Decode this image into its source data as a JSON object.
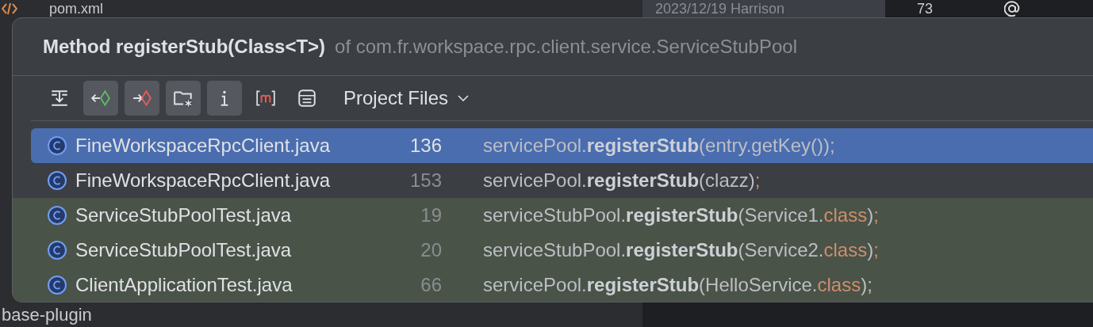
{
  "background": {
    "file_tab": "pom.xml",
    "blame": "2023/12/19 Harrison",
    "count": "73",
    "module": "base-plugin"
  },
  "popup": {
    "title": {
      "method": "Method registerStub(Class<T>)",
      "owner": "of com.fr.workspace.rpc.client.service.ServiceStubPool"
    },
    "toolbar": [
      {
        "on": false
      },
      {
        "on": true
      },
      {
        "on": true
      },
      {
        "on": true
      },
      {
        "on": true
      },
      {
        "on": false
      },
      {
        "on": false
      }
    ],
    "scope": {
      "label": "Project Files"
    },
    "results": [
      {
        "file": "FineWorkspaceRpcClient.java",
        "line": "136",
        "selected": true,
        "test_scope": false,
        "code": [
          {
            "kind": "plain",
            "text": "servicePool."
          },
          {
            "kind": "method",
            "text": "registerStub"
          },
          {
            "kind": "plain",
            "text": "(entry.getKey());"
          }
        ]
      },
      {
        "file": "FineWorkspaceRpcClient.java",
        "line": "153",
        "selected": false,
        "test_scope": false,
        "code": [
          {
            "kind": "plain",
            "text": "servicePool."
          },
          {
            "kind": "method",
            "text": "registerStub"
          },
          {
            "kind": "plain",
            "text": "(clazz)"
          },
          {
            "kind": "keyword",
            "text": ";"
          }
        ]
      },
      {
        "file": "ServiceStubPoolTest.java",
        "line": "19",
        "selected": false,
        "test_scope": true,
        "code": [
          {
            "kind": "plain",
            "text": "serviceStubPool."
          },
          {
            "kind": "method",
            "text": "registerStub"
          },
          {
            "kind": "plain",
            "text": "(Service1."
          },
          {
            "kind": "keyword",
            "text": "class"
          },
          {
            "kind": "plain",
            "text": ")"
          },
          {
            "kind": "keyword",
            "text": ";"
          }
        ]
      },
      {
        "file": "ServiceStubPoolTest.java",
        "line": "20",
        "selected": false,
        "test_scope": true,
        "code": [
          {
            "kind": "plain",
            "text": "serviceStubPool."
          },
          {
            "kind": "method",
            "text": "registerStub"
          },
          {
            "kind": "plain",
            "text": "(Service2."
          },
          {
            "kind": "keyword",
            "text": "class"
          },
          {
            "kind": "plain",
            "text": ")"
          },
          {
            "kind": "keyword",
            "text": ";"
          }
        ]
      },
      {
        "file": "ClientApplicationTest.java",
        "line": "66",
        "selected": false,
        "test_scope": true,
        "code": [
          {
            "kind": "plain",
            "text": "servicePool."
          },
          {
            "kind": "method",
            "text": "registerStub"
          },
          {
            "kind": "plain",
            "text": "(HelloService."
          },
          {
            "kind": "keyword",
            "text": "class"
          },
          {
            "kind": "plain",
            "text": ");"
          }
        ]
      }
    ]
  }
}
